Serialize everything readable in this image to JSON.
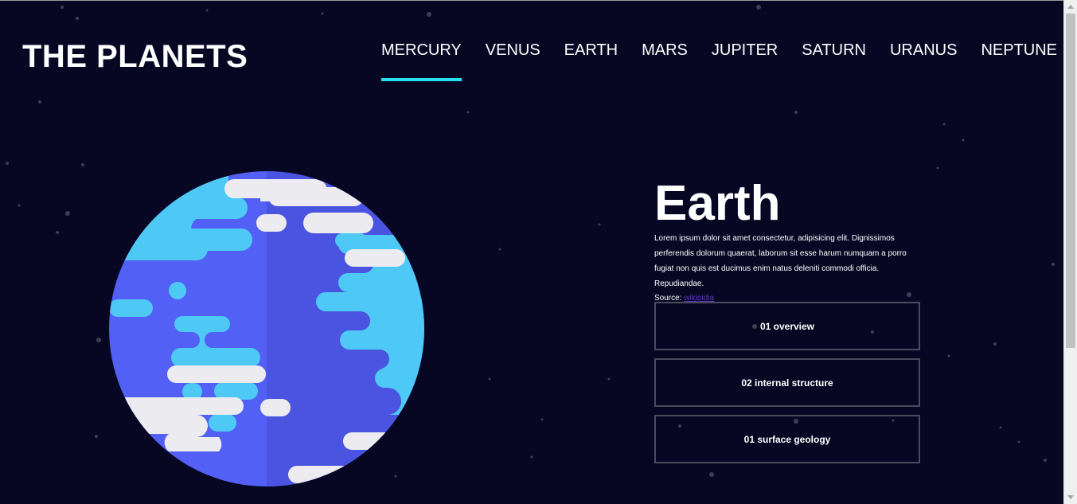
{
  "header": {
    "logo": "THE PLANETS",
    "nav": [
      "MERCURY",
      "VENUS",
      "EARTH",
      "MARS",
      "JUPITER",
      "SATURN",
      "URANUS",
      "NEPTUNE"
    ],
    "active_nav": "MERCURY"
  },
  "planet": {
    "name": "Earth",
    "description": "Lorem ipsum dolor sit amet consectetur, adipisicing elit. Dignissimos perferendis dolorum quaerat, laborum sit esse harum numquam a porro fugiat non quis est ducimus enim natus deleniti commodi officia. Repudiandae.",
    "source_label": "Source: ",
    "source_link": "wikipidia"
  },
  "tabs": {
    "overview": "01 overview",
    "structure": "02 internal structure",
    "geology": "01 surface geology"
  },
  "colors": {
    "background": "#070724",
    "active_underline": "#26e0f0",
    "ocean": "#4f5be8",
    "land": "#4ec9f5",
    "cloud": "#ececf0"
  }
}
